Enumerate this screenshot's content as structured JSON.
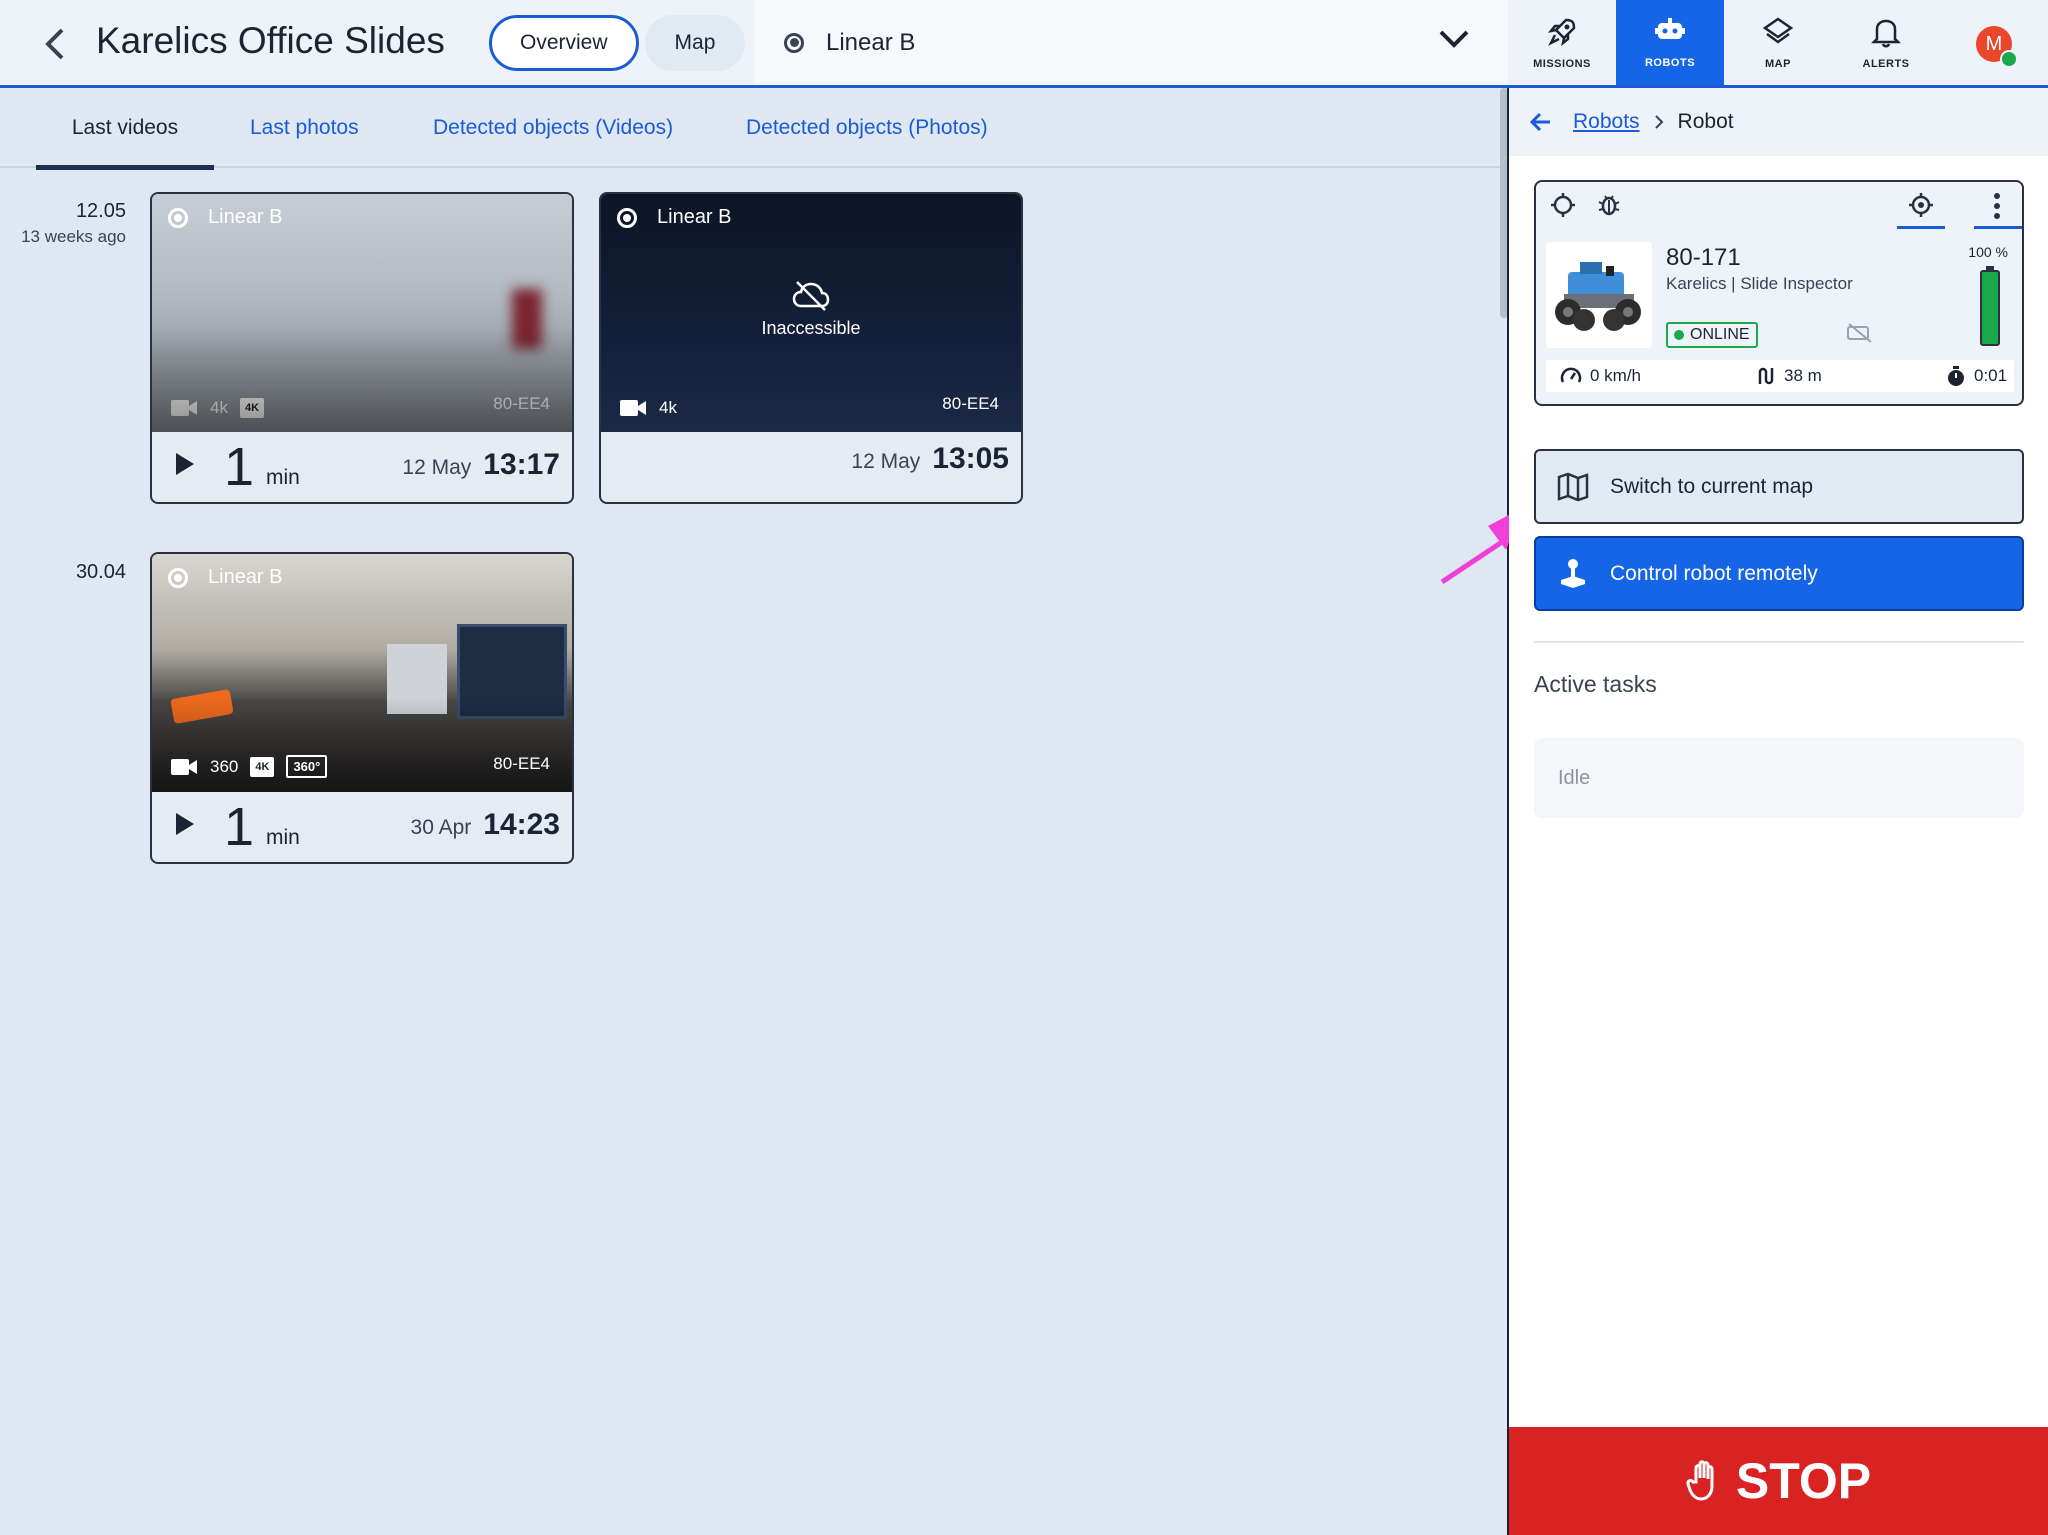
{
  "header": {
    "title": "Karelics Office Slides",
    "view_toggle": [
      "Overview",
      "Map"
    ],
    "route": "Linear B",
    "nav": [
      {
        "label": "MISSIONS",
        "icon": "rocket-icon"
      },
      {
        "label": "ROBOTS",
        "icon": "robot-icon"
      },
      {
        "label": "MAP",
        "icon": "layers-icon"
      },
      {
        "label": "ALERTS",
        "icon": "bell-icon"
      }
    ],
    "avatar_initial": "M"
  },
  "tabs": [
    "Last videos",
    "Last photos",
    "Detected objects (Videos)",
    "Detected objects (Photos)"
  ],
  "groups": [
    {
      "date": "12.05",
      "relative": "13 weeks ago",
      "videos": [
        {
          "route": "Linear B",
          "format": "4k",
          "badge": "4K",
          "robot": "80-EE4",
          "duration": "1",
          "unit": "min",
          "day": "12 May",
          "time": "13:17"
        },
        {
          "route": "Linear B",
          "format": "4k",
          "robot": "80-EE4",
          "status": "Inaccessible",
          "day": "12 May",
          "time": "13:05"
        }
      ]
    },
    {
      "date": "30.04",
      "videos": [
        {
          "route": "Linear B",
          "format": "360",
          "badge": "4K",
          "badge2": "360°",
          "robot": "80-EE4",
          "duration": "1",
          "unit": "min",
          "day": "30 Apr",
          "time": "14:23"
        }
      ]
    }
  ],
  "panel": {
    "breadcrumb": {
      "link": "Robots",
      "current": "Robot"
    },
    "robot": {
      "id": "80-171",
      "subtitle": "Karelics | Slide Inspector",
      "status": "ONLINE",
      "battery": "100 %",
      "battery_level": 1.0,
      "speed": "0 km/h",
      "distance": "38 m",
      "time": "0:01"
    },
    "switch_map": "Switch to current map",
    "control": "Control robot remotely",
    "active_tasks": "Active tasks",
    "idle": "Idle",
    "stop": "STOP"
  },
  "colors": {
    "accent": "#1565e6",
    "stop": "#d92323",
    "online": "#1aa84a",
    "annotation": "#f040d8"
  }
}
